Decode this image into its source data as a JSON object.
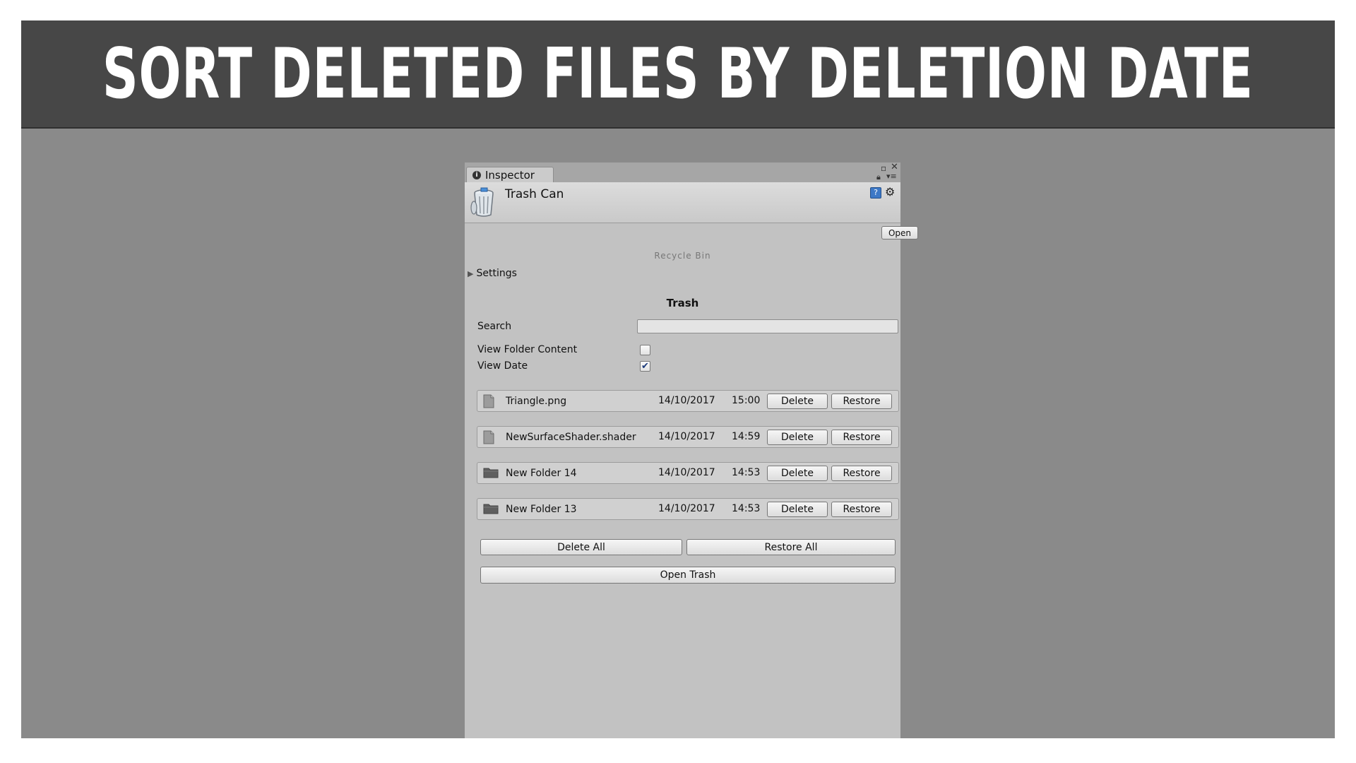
{
  "banner": {
    "title": "SORT DELETED FILES BY DELETION DATE"
  },
  "tab": {
    "label": "Inspector"
  },
  "header": {
    "title": "Trash Can",
    "open_label": "Open"
  },
  "panel": {
    "subtitle": "Recycle Bin",
    "settings_label": "Settings",
    "section_title": "Trash",
    "search_label": "Search",
    "search_value": "",
    "view_folder_label": "View Folder Content",
    "view_folder_checked": false,
    "view_date_label": "View Date",
    "view_date_checked": true
  },
  "items": [
    {
      "name": "Triangle.png",
      "type": "file",
      "date": "14/10/2017",
      "time": "15:00",
      "delete_label": "Delete",
      "restore_label": "Restore"
    },
    {
      "name": "NewSurfaceShader.shader",
      "type": "file",
      "date": "14/10/2017",
      "time": "14:59",
      "delete_label": "Delete",
      "restore_label": "Restore"
    },
    {
      "name": "New Folder 14",
      "type": "folder",
      "date": "14/10/2017",
      "time": "14:53",
      "delete_label": "Delete",
      "restore_label": "Restore"
    },
    {
      "name": "New Folder 13",
      "type": "folder",
      "date": "14/10/2017",
      "time": "14:53",
      "delete_label": "Delete",
      "restore_label": "Restore"
    }
  ],
  "actions": {
    "delete_all": "Delete All",
    "restore_all": "Restore All",
    "open_trash": "Open Trash"
  },
  "icons": {
    "tab": "info-icon",
    "header": "trash-can-icon",
    "help": "help-icon",
    "settings": "gear-icon",
    "file": "file-icon",
    "folder": "folder-icon"
  },
  "colors": {
    "banner_bg": "#474747",
    "frame_bg": "#8a8a8a",
    "panel_bg": "#c2c2c2",
    "check": "#1b3a7a"
  }
}
